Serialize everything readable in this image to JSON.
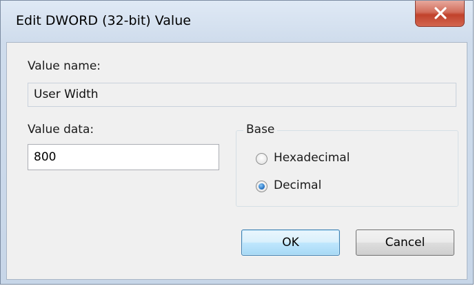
{
  "window": {
    "title": "Edit DWORD (32-bit) Value"
  },
  "fields": {
    "value_name_label": "Value name:",
    "value_name": "User Width",
    "value_data_label": "Value data:",
    "value_data": "800"
  },
  "base": {
    "title": "Base",
    "options": [
      {
        "label": "Hexadecimal",
        "selected": false
      },
      {
        "label": "Decimal",
        "selected": true
      }
    ]
  },
  "buttons": {
    "ok": "OK",
    "cancel": "Cancel"
  },
  "icons": {
    "close": "close-icon"
  }
}
